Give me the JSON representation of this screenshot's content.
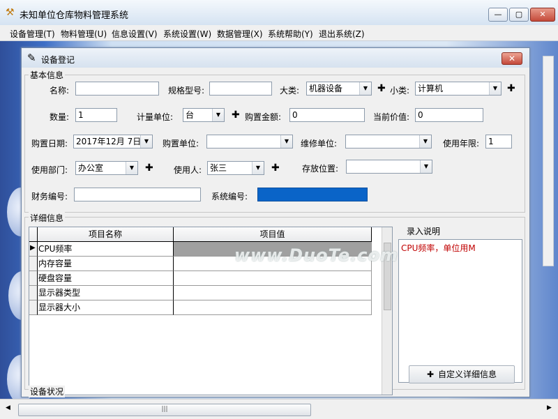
{
  "app": {
    "title": "未知单位仓库物料管理系统"
  },
  "menu": [
    "设备管理(T)",
    "物料管理(U)",
    "信息设置(V)",
    "系统设置(W)",
    "数据管理(X)",
    "系统帮助(Y)",
    "退出系统(Z)"
  ],
  "dialog": {
    "title": "设备登记",
    "basic_group": "基本信息",
    "detail_group": "详细信息",
    "status_group": "设备状况",
    "fields": {
      "name_label": "名称:",
      "name_value": "",
      "spec_label": "规格型号:",
      "spec_value": "",
      "category_label": "大类:",
      "category_value": "机器设备",
      "subcategory_label": "小类:",
      "subcategory_value": "计算机",
      "qty_label": "数量:",
      "qty_value": "1",
      "unit_label": "计量单位:",
      "unit_value": "台",
      "amount_label": "购置金额:",
      "amount_value": "0",
      "current_label": "当前价值:",
      "current_value": "0",
      "date_label": "购置日期:",
      "date_value": "2017年12月 7日",
      "buy_unit_label": "购置单位:",
      "buy_unit_value": "",
      "repair_label": "维修单位:",
      "repair_value": "",
      "years_label": "使用年限:",
      "years_value": "1",
      "dept_label": "使用部门:",
      "dept_value": "办公室",
      "user_label": "使用人:",
      "user_value": "张三",
      "location_label": "存放位置:",
      "location_value": "",
      "fin_label": "财务编号:",
      "fin_value": "",
      "sys_label": "系统编号:",
      "sys_value": ""
    },
    "grid": {
      "headers": [
        "项目名称",
        "项目值"
      ],
      "rows": [
        "CPU频率",
        "内存容量",
        "硬盘容量",
        "显示器类型",
        "显示器大小"
      ]
    },
    "note": {
      "title": "录入说明",
      "text": "CPU频率，单位用M"
    },
    "custom_button": "自定义详细信息"
  },
  "watermark": "www.DuoTe.com",
  "colors": {
    "sys_field": "#0a64c8",
    "note_text": "#c00000",
    "selected_cell": "#a0a0a0"
  }
}
